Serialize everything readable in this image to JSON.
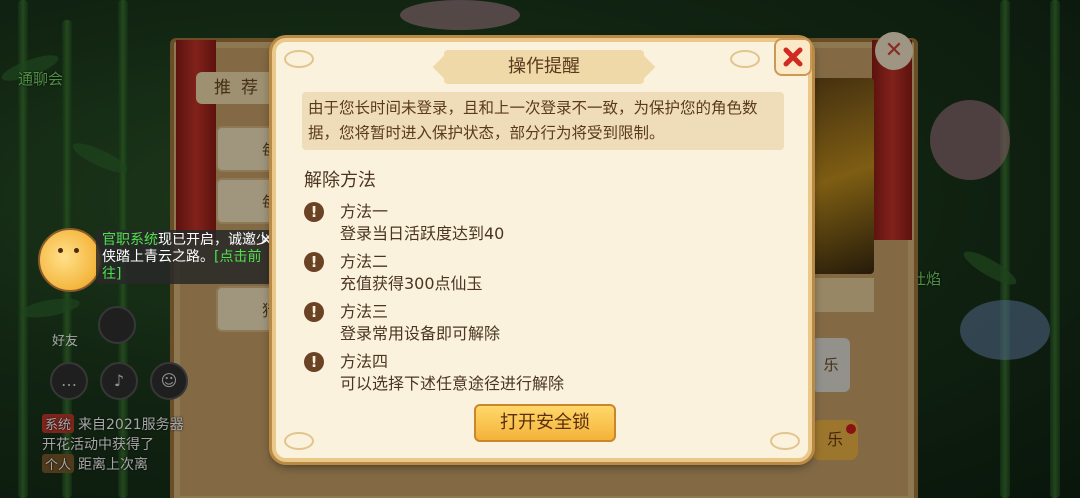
{
  "background": {
    "tab_label": "推荐",
    "side_btn1": "每",
    "side_btn2": "每",
    "side_btn3": "猎",
    "right_btn_le": "乐",
    "right_btn_le2": "乐",
    "friend_label": "好友",
    "chat": [
      {
        "tag": "系统",
        "tag_color": "#c0392b",
        "text": "来自2021服务器"
      },
      {
        "tag": "",
        "tag_color": "",
        "text": "开花活动中获得了"
      },
      {
        "tag": "个人",
        "tag_color": "#7a5a2a",
        "text": "距离上次离"
      }
    ],
    "side_text1": "通聊会",
    "side_text2": "水吐焰"
  },
  "notification": {
    "highlight": "官职系统",
    "text": "现已开启，诚邀少侠踏上青云之路。",
    "link": "[点击前往]"
  },
  "dialog": {
    "title": "操作提醒",
    "message": "由于您长时间未登录，且和上一次登录不一致，为保护您的角色数据，您将暂时进入保护状态，部分行为将受到限制。",
    "section_title": "解除方法",
    "methods": [
      {
        "name": "方法一",
        "desc": "登录当日活跃度达到40"
      },
      {
        "name": "方法二",
        "desc": "充值获得300点仙玉"
      },
      {
        "name": "方法三",
        "desc": "登录常用设备即可解除"
      },
      {
        "name": "方法四",
        "desc": "可以选择下述任意途径进行解除"
      }
    ],
    "button_label": "打开安全锁",
    "close_icon": "close-icon",
    "close_color": "#d12a22"
  }
}
